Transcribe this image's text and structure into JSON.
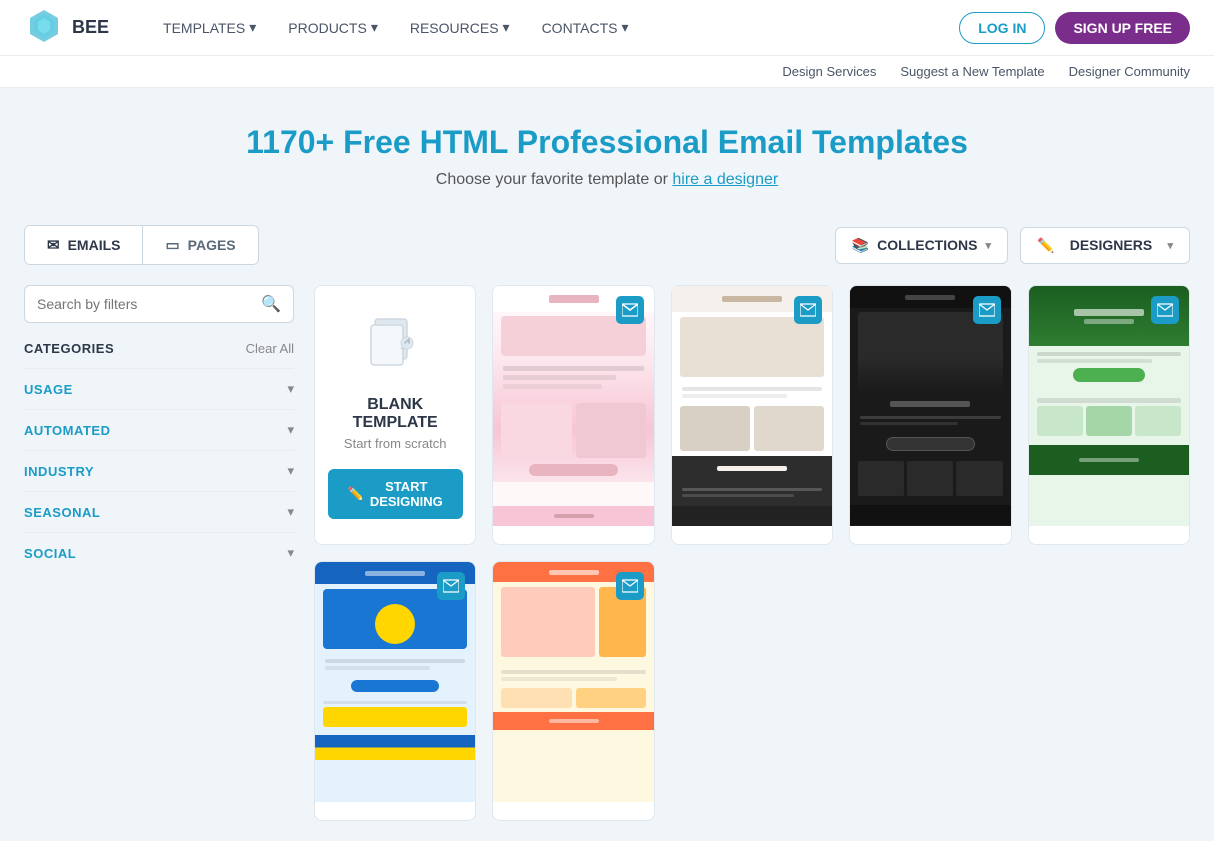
{
  "navbar": {
    "logo_text": "BEE",
    "nav_items": [
      {
        "label": "TEMPLATES",
        "has_arrow": true
      },
      {
        "label": "PRODUCTS",
        "has_arrow": true
      },
      {
        "label": "RESOURCES",
        "has_arrow": true
      },
      {
        "label": "CONTACTS",
        "has_arrow": true
      }
    ],
    "login_label": "LOG IN",
    "signup_label": "SIGN UP FREE"
  },
  "secondary_nav": {
    "links": [
      "Design Services",
      "Suggest a New Template",
      "Designer Community"
    ]
  },
  "hero": {
    "title": "1170+ Free HTML Professional Email Templates",
    "subtitle": "Choose your favorite template or ",
    "link_text": "hire a designer"
  },
  "tabs": [
    {
      "label": "EMAILS",
      "icon": "✉",
      "active": true
    },
    {
      "label": "PAGES",
      "icon": "▭",
      "active": false
    }
  ],
  "dropdowns": [
    {
      "icon": "📚",
      "label": "COLLECTIONS",
      "has_arrow": true
    },
    {
      "icon": "✏️",
      "label": "DESIGNERS",
      "has_arrow": true
    }
  ],
  "sidebar": {
    "search_placeholder": "Search by filters",
    "categories_label": "CATEGORIES",
    "clear_all": "Clear All",
    "filters": [
      {
        "label": "USAGE"
      },
      {
        "label": "AUTOMATED"
      },
      {
        "label": "INDUSTRY"
      },
      {
        "label": "SEASONAL"
      },
      {
        "label": "SOCIAL"
      }
    ]
  },
  "blank_template": {
    "title": "BLANK TEMPLATE",
    "subtitle": "Start from scratch",
    "btn_label": "START DESIGNING"
  },
  "templates": [
    {
      "id": 1,
      "theme": "pink",
      "has_badge": true
    },
    {
      "id": 2,
      "theme": "neutral",
      "has_badge": true
    },
    {
      "id": 3,
      "theme": "dark",
      "has_badge": true
    },
    {
      "id": 4,
      "theme": "green",
      "has_badge": true
    },
    {
      "id": 5,
      "theme": "blue-yellow",
      "has_badge": true
    },
    {
      "id": 6,
      "theme": "edu",
      "has_badge": true
    }
  ]
}
